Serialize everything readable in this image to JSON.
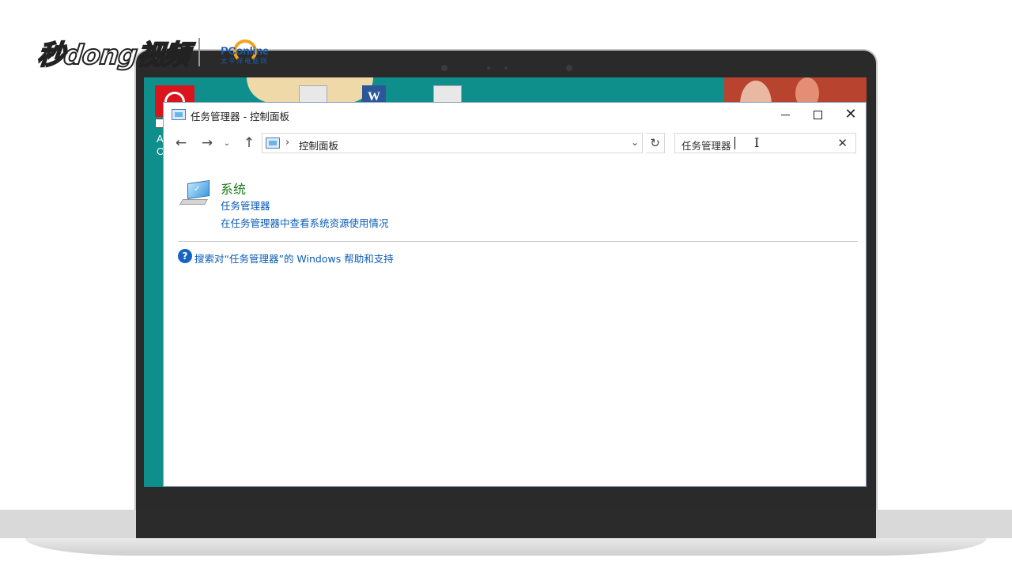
{
  "watermark": {
    "brand_text": "秒dong视频",
    "partner_text": "PConline",
    "partner_sub": "太平洋电脑网"
  },
  "desktop": {
    "side_letters": [
      "A",
      "C"
    ],
    "word_icon_letter": "W"
  },
  "window": {
    "title": "任务管理器 - 控制面板",
    "controls": {
      "minimize": "",
      "maximize": "",
      "close": "✕"
    }
  },
  "navigation": {
    "back_glyph": "←",
    "forward_glyph": "→",
    "recent_glyph": "⌄",
    "up_glyph": "↑",
    "breadcrumb_separator": "›",
    "address_text": "控制面板",
    "dropdown_glyph": "⌄",
    "refresh_glyph": "↻"
  },
  "search": {
    "value": "任务管理器",
    "clear_glyph": "✕"
  },
  "results": {
    "category_title": "系统",
    "link_1": "任务管理器",
    "link_2": "在任务管理器中查看系统资源使用情况"
  },
  "help": {
    "icon_glyph": "?",
    "link_text": "搜索对“任务管理器”的 Windows 帮助和支持"
  },
  "colors": {
    "desktop_teal": "#0f8f8b",
    "link_blue": "#0a5bb5",
    "category_green": "#1b7a1b"
  }
}
